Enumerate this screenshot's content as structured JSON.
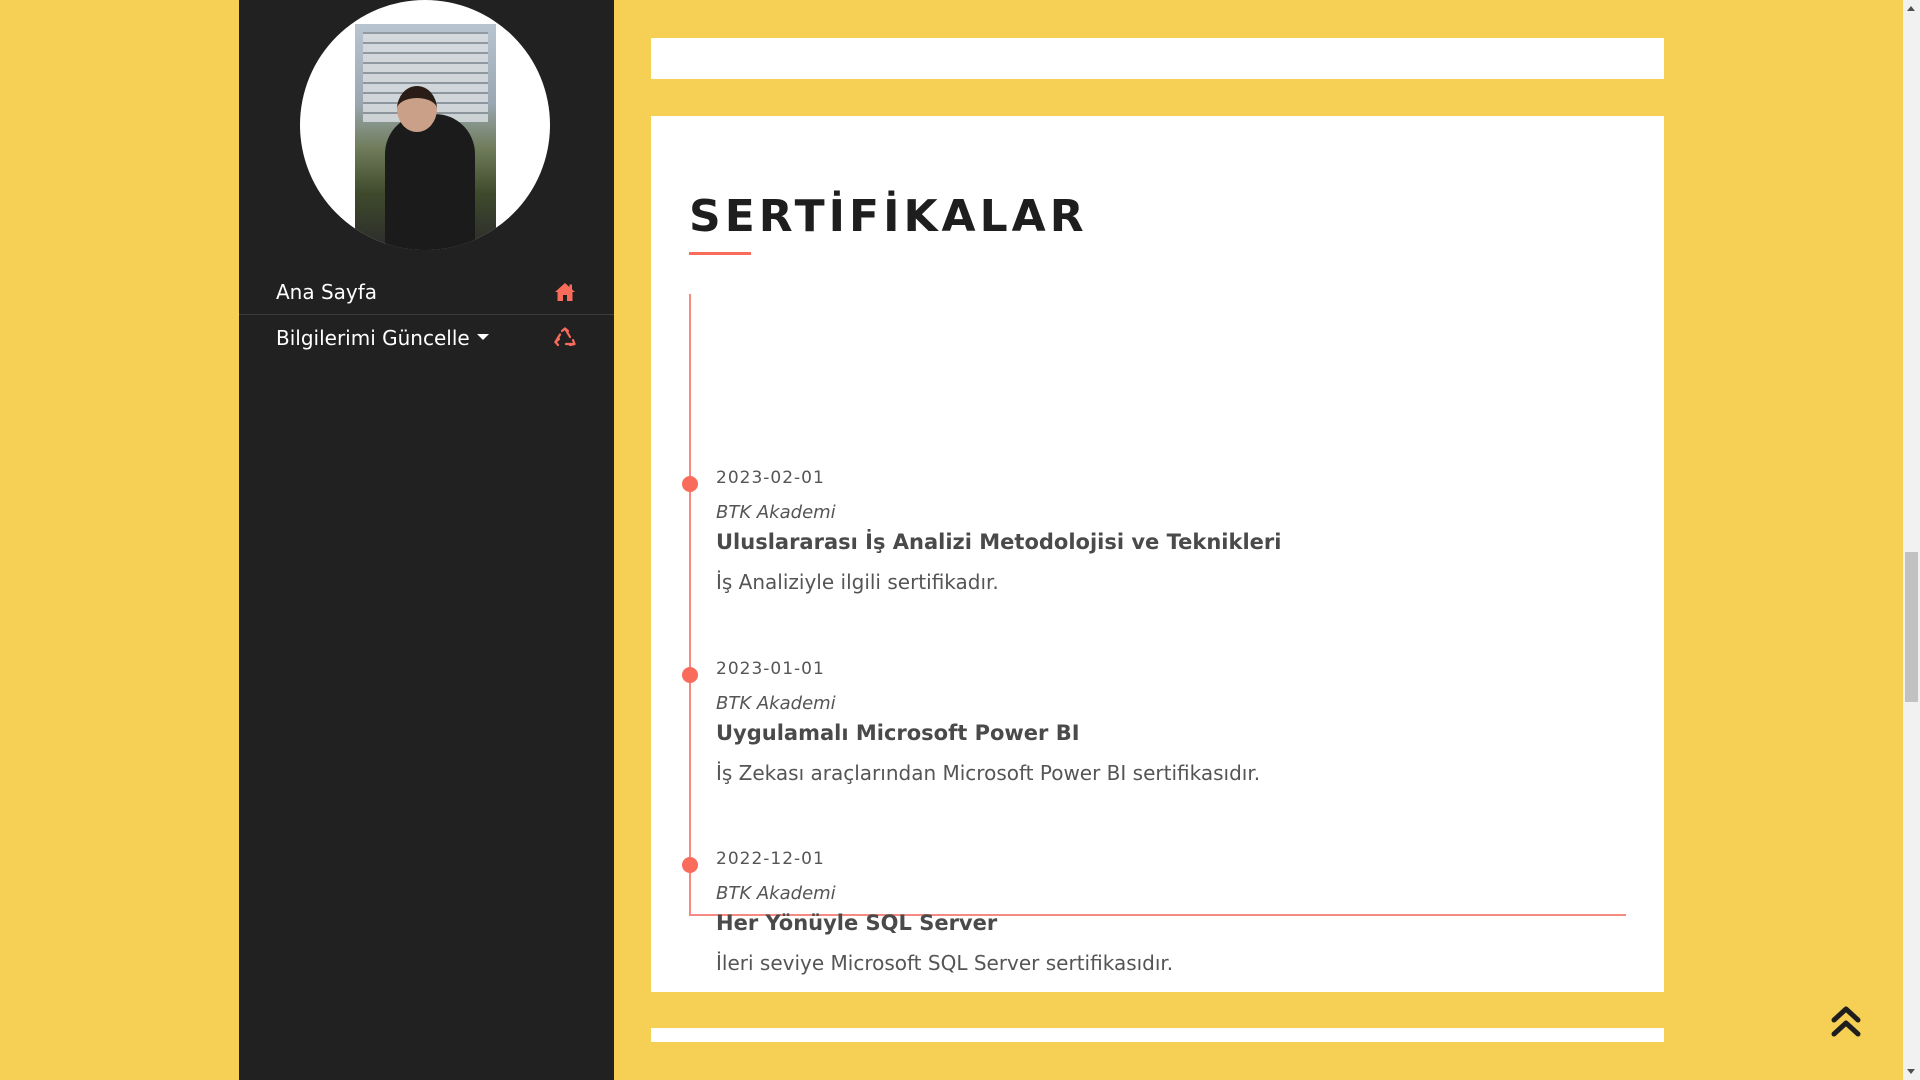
{
  "sidebar": {
    "nav": [
      {
        "label": "Ana Sayfa",
        "icon": "home-icon",
        "icon_color": "#f96b5b"
      },
      {
        "label": "Bilgilerimi Güncelle",
        "icon": "recycle-icon",
        "icon_color": "#f96b5b",
        "has_dropdown": true
      }
    ]
  },
  "certificates": {
    "title": "SERTİFİKALAR",
    "accent_color": "#f96b5b",
    "items": [
      {
        "date": "2023-02-01",
        "org": "BTK Akademi",
        "title": "Uluslararası İş Analizi Metodolojisi ve Teknikleri",
        "description": "İş Analiziyle ilgili sertifikadır."
      },
      {
        "date": "2023-01-01",
        "org": "BTK Akademi",
        "title": "Uygulamalı Microsoft Power BI",
        "description": "İş Zekası araçlarından Microsoft Power BI sertifikasıdır."
      },
      {
        "date": "2022-12-01",
        "org": "BTK Akademi",
        "title": "Her Yönüyle SQL Server",
        "description": "İleri seviye Microsoft SQL Server sertifikasıdır."
      }
    ]
  },
  "colors": {
    "page_background": "#f6d055",
    "sidebar_background": "#212121",
    "card_background": "#ffffff"
  },
  "scroll_top": {
    "icon": "double-chevron-up-icon"
  }
}
